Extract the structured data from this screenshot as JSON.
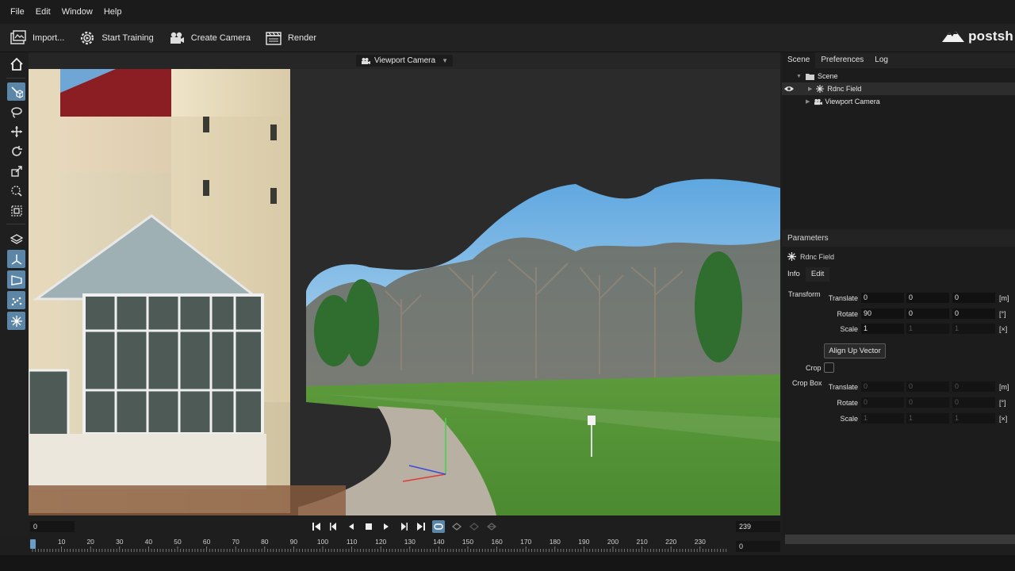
{
  "menu": {
    "items": [
      "File",
      "Edit",
      "Window",
      "Help"
    ]
  },
  "toolbar": {
    "import_label": "Import...",
    "start_training_label": "Start Training",
    "create_camera_label": "Create Camera",
    "render_label": "Render"
  },
  "brand": {
    "name": "postsh"
  },
  "viewport": {
    "camera_label": "Viewport Camera"
  },
  "scene_panel": {
    "tabs": [
      "Scene",
      "Preferences",
      "Log"
    ],
    "tree": {
      "root": "Scene",
      "field": "Rdnc Field",
      "camera": "Viewport Camera"
    }
  },
  "params": {
    "header": "Parameters",
    "object_name": "Rdnc Field",
    "tabs": [
      "Info",
      "Edit"
    ],
    "transform_label": "Transform",
    "translate_label": "Translate",
    "rotate_label": "Rotate",
    "scale_label": "Scale",
    "translate": [
      "0",
      "0",
      "0"
    ],
    "rotate": [
      "90",
      "0",
      "0"
    ],
    "scale": [
      "1",
      "1",
      "1"
    ],
    "translate_unit": "[m]",
    "rotate_unit": "[°]",
    "scale_unit": "[×]",
    "align_button": "Align Up Vector",
    "crop_label": "Crop",
    "cropbox_label": "Crop Box",
    "cropbox_translate": [
      "0",
      "0",
      "0"
    ],
    "cropbox_rotate": [
      "0",
      "0",
      "0"
    ],
    "cropbox_scale": [
      "1",
      "1",
      "1"
    ]
  },
  "timeline": {
    "start_frame": "0",
    "end_frame": "239",
    "current_frame": "0",
    "ticks": [
      "10",
      "20",
      "30",
      "40",
      "50",
      "60",
      "70",
      "80",
      "90",
      "100",
      "110",
      "120",
      "130",
      "140",
      "150",
      "160",
      "170",
      "180",
      "190",
      "200",
      "210",
      "220",
      "230"
    ]
  }
}
